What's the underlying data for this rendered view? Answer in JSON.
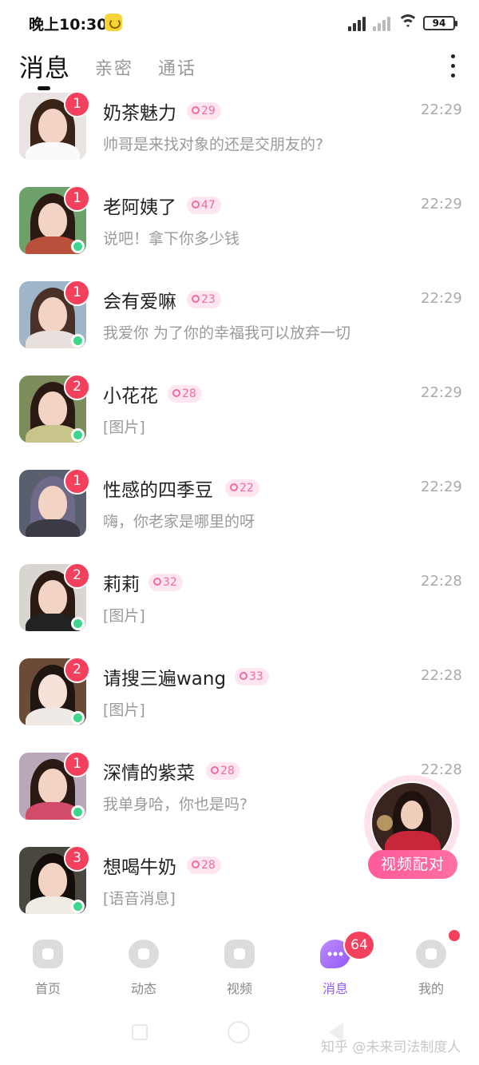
{
  "status_bar": {
    "time": "晚上10:30",
    "battery": "94"
  },
  "header": {
    "active_tab": "消息",
    "tabs": [
      "亲密",
      "通话"
    ]
  },
  "conversations": [
    {
      "name": "奶茶魅力",
      "level": "29",
      "time": "22:29",
      "preview": "帅哥是来找对象的还是交朋友的?",
      "unread": "1",
      "online": false
    },
    {
      "name": "老阿姨了",
      "level": "47",
      "time": "22:29",
      "preview": "说吧！拿下你多少钱",
      "unread": "1",
      "online": true
    },
    {
      "name": "会有爱嘛",
      "level": "23",
      "time": "22:29",
      "preview": "我爱你 为了你的幸福我可以放弃一切",
      "unread": "1",
      "online": true
    },
    {
      "name": "小花花",
      "level": "28",
      "time": "22:29",
      "preview": "[图片]",
      "unread": "2",
      "online": true
    },
    {
      "name": "性感的四季豆",
      "level": "22",
      "time": "22:29",
      "preview": "嗨，你老家是哪里的呀",
      "unread": "1",
      "online": false
    },
    {
      "name": "莉莉",
      "level": "32",
      "time": "22:28",
      "preview": "[图片]",
      "unread": "2",
      "online": true
    },
    {
      "name": "请搜三遍wang",
      "level": "33",
      "time": "22:28",
      "preview": "[图片]",
      "unread": "2",
      "online": true
    },
    {
      "name": "深情的紫菜",
      "level": "28",
      "time": "22:28",
      "preview": "我单身哈，你也是吗?",
      "unread": "1",
      "online": true
    },
    {
      "name": "想喝牛奶",
      "level": "28",
      "time": "",
      "preview": "[语音消息]",
      "unread": "3",
      "online": true
    }
  ],
  "video_match": {
    "label": "视频配对"
  },
  "bottom_nav": {
    "items": [
      "首页",
      "动态",
      "视频",
      "消息",
      "我的"
    ],
    "active": "消息",
    "badge": "64"
  },
  "watermark": "知乎 @未来司法制度人",
  "colors": {
    "accent": "#8f5af5",
    "badge": "#f2405d",
    "online": "#3ed68a",
    "level_bg": "#fde6f0",
    "level_text": "#f06aa5"
  }
}
